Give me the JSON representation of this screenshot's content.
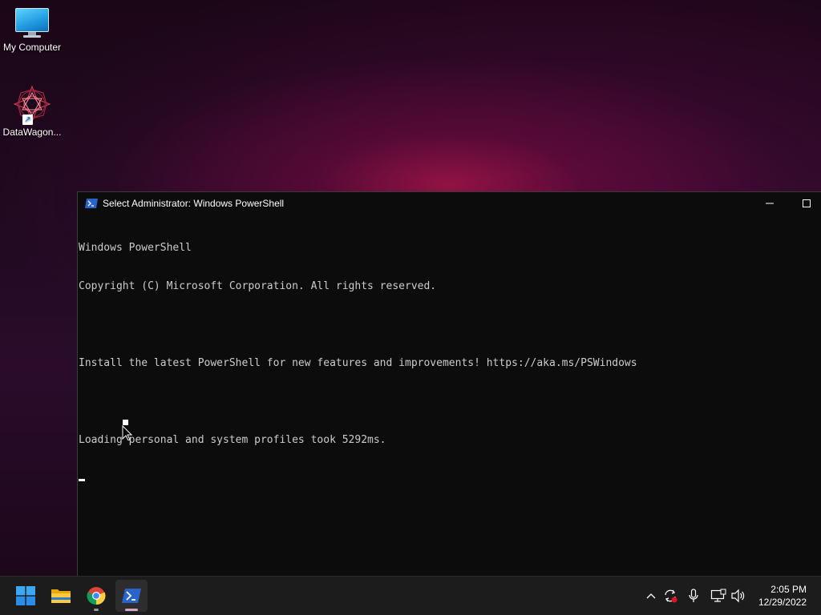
{
  "desktop": {
    "icons": [
      {
        "label": "My Computer",
        "icon": "monitor-icon"
      },
      {
        "label": "DataWagon...",
        "icon": "datawagon-shortcut-icon"
      }
    ]
  },
  "window": {
    "title": "Select Administrator: Windows PowerShell",
    "icon": "powershell-icon",
    "console_lines": [
      "Windows PowerShell",
      "Copyright (C) Microsoft Corporation. All rights reserved.",
      "",
      "Install the latest PowerShell for new features and improvements! https://aka.ms/PSWindows",
      "",
      "Loading personal and system profiles took 5292ms."
    ]
  },
  "taskbar": {
    "apps": [
      {
        "name": "start",
        "icon": "windows-start-icon"
      },
      {
        "name": "file-explorer",
        "icon": "folder-icon"
      },
      {
        "name": "chrome",
        "icon": "chrome-icon",
        "running": true
      },
      {
        "name": "powershell",
        "icon": "powershell-icon",
        "running": true,
        "active": true
      }
    ],
    "tray": [
      "chevron-up-icon",
      "sync-icon",
      "microphone-icon",
      "network-icon",
      "volume-icon"
    ],
    "clock": {
      "time": "2:05 PM",
      "date": "12/29/2022"
    }
  },
  "colors": {
    "console_bg": "#0c0c0c",
    "console_text": "#cccccc",
    "taskbar_bg": "#1c1c1c",
    "powershell_blue": "#2a63c9"
  }
}
